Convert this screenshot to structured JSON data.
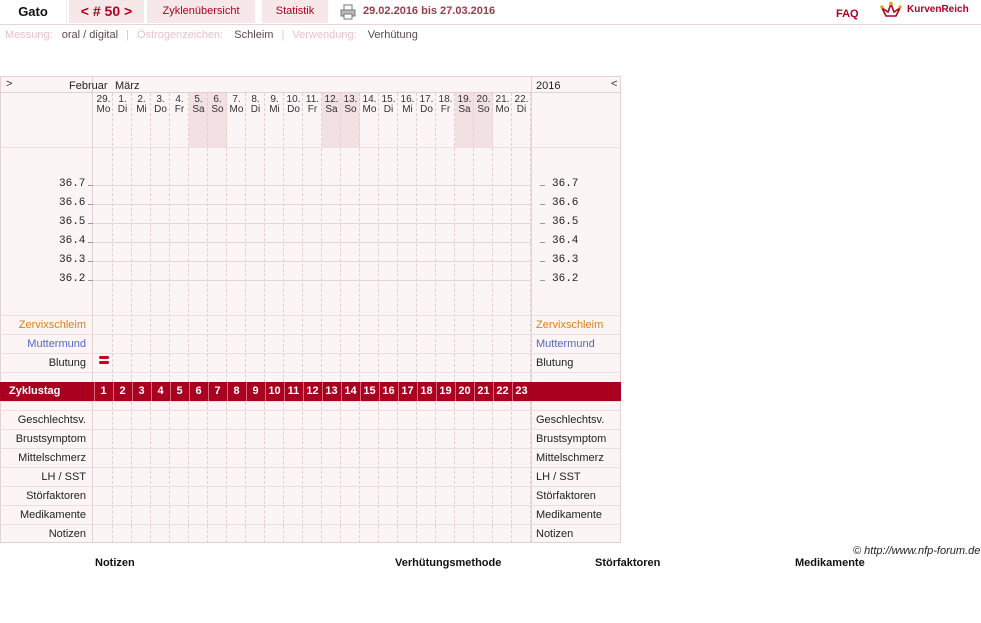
{
  "header": {
    "user": "Gato",
    "cycle": "< # 50 >",
    "overview_tab": "Zyklenübersicht",
    "stats_tab": "Statistik",
    "date_range": "29.02.2016 bis 27.03.2016",
    "faq": "FAQ",
    "logo": "KurvenReich"
  },
  "info": {
    "measure_label": "Messung:",
    "measure_value": "oral / digital",
    "estrogen_label": "Östrogenzeichen:",
    "estrogen_value": "Schleim",
    "usage_label": "Verwendung:",
    "usage_value": "Verhütung"
  },
  "chart": {
    "nav_prev": ">",
    "nav_next": "<",
    "month_feb": "Februar",
    "month_mar": "März",
    "year": "2016",
    "days": [
      {
        "d": "29.",
        "w": "Mo",
        "we": false
      },
      {
        "d": "1.",
        "w": "Di",
        "we": false
      },
      {
        "d": "2.",
        "w": "Mi",
        "we": false
      },
      {
        "d": "3.",
        "w": "Do",
        "we": false
      },
      {
        "d": "4.",
        "w": "Fr",
        "we": false
      },
      {
        "d": "5.",
        "w": "Sa",
        "we": true
      },
      {
        "d": "6.",
        "w": "So",
        "we": true
      },
      {
        "d": "7.",
        "w": "Mo",
        "we": false
      },
      {
        "d": "8.",
        "w": "Di",
        "we": false
      },
      {
        "d": "9.",
        "w": "Mi",
        "we": false
      },
      {
        "d": "10.",
        "w": "Do",
        "we": false
      },
      {
        "d": "11.",
        "w": "Fr",
        "we": false
      },
      {
        "d": "12.",
        "w": "Sa",
        "we": true
      },
      {
        "d": "13.",
        "w": "So",
        "we": true
      },
      {
        "d": "14.",
        "w": "Mo",
        "we": false
      },
      {
        "d": "15.",
        "w": "Di",
        "we": false
      },
      {
        "d": "16.",
        "w": "Mi",
        "we": false
      },
      {
        "d": "17.",
        "w": "Do",
        "we": false
      },
      {
        "d": "18.",
        "w": "Fr",
        "we": false
      },
      {
        "d": "19.",
        "w": "Sa",
        "we": true
      },
      {
        "d": "20.",
        "w": "So",
        "we": true
      },
      {
        "d": "21.",
        "w": "Mo",
        "we": false
      },
      {
        "d": "22.",
        "w": "Di",
        "we": false
      }
    ],
    "temps": [
      "36.7",
      "36.6",
      "36.5",
      "36.4",
      "36.3",
      "36.2"
    ],
    "zervix": "Zervixschleim",
    "muttermund": "Muttermund",
    "blutung": "Blutung",
    "zyklustag": "Zyklustag",
    "cycle_days": [
      "1",
      "2",
      "3",
      "4",
      "5",
      "6",
      "7",
      "8",
      "9",
      "10",
      "11",
      "12",
      "13",
      "14",
      "15",
      "16",
      "17",
      "18",
      "19",
      "20",
      "21",
      "22",
      "23"
    ],
    "lower_rows": [
      "Geschlechtsv.",
      "Brustsymptom",
      "Mittelschmerz",
      "LH / SST",
      "Störfaktoren",
      "Medikamente",
      "Notizen"
    ],
    "colors": {
      "zervix": "#e08010",
      "muttermund": "#5566cc",
      "zyklus_bar": "#a8001e"
    }
  },
  "footer": {
    "copyright": "© http://www.nfp-forum.de",
    "notes": "Notizen",
    "method": "Verhütungsmethode",
    "disturb": "Störfaktoren",
    "meds": "Medikamente"
  }
}
